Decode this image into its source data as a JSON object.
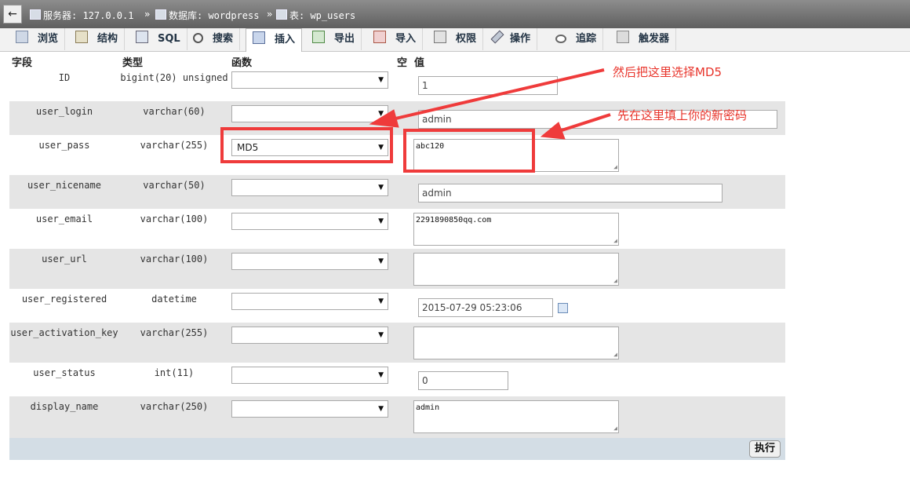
{
  "breadcrumb": {
    "back": "←",
    "server": "服务器: 127.0.0.1",
    "database": "数据库: wordpress",
    "table": "表: wp_users",
    "sep": "»"
  },
  "tabs": [
    "浏览",
    "结构",
    "SQL",
    "搜索",
    "插入",
    "导出",
    "导入",
    "权限",
    "操作",
    "追踪",
    "触发器"
  ],
  "active_tab": "插入",
  "columns": {
    "field": "字段",
    "type": "类型",
    "function": "函数",
    "null": "空",
    "value": "值"
  },
  "rows": [
    {
      "field": "ID",
      "type": "bigint(20) unsigned",
      "function": "",
      "value": "1"
    },
    {
      "field": "user_login",
      "type": "varchar(60)",
      "function": "",
      "value": "admin"
    },
    {
      "field": "user_pass",
      "type": "varchar(255)",
      "function": "MD5",
      "value": "abc120"
    },
    {
      "field": "user_nicename",
      "type": "varchar(50)",
      "function": "",
      "value": "admin"
    },
    {
      "field": "user_email",
      "type": "varchar(100)",
      "function": "",
      "value": "2291890850qq.com"
    },
    {
      "field": "user_url",
      "type": "varchar(100)",
      "function": "",
      "value": ""
    },
    {
      "field": "user_registered",
      "type": "datetime",
      "function": "",
      "value": "2015-07-29 05:23:06"
    },
    {
      "field": "user_activation_key",
      "type": "varchar(255)",
      "function": "",
      "value": ""
    },
    {
      "field": "user_status",
      "type": "int(11)",
      "function": "",
      "value": "0"
    },
    {
      "field": "display_name",
      "type": "varchar(250)",
      "function": "",
      "value": "admin"
    }
  ],
  "execute_label": "执行",
  "annotations": {
    "md5_note": "然后把这里选择MD5",
    "password_note": "先在这里填上你的新密码"
  },
  "colors": {
    "annotation": "#e8342b",
    "row_alt": "#e5e5e5",
    "footer": "#d3dde5"
  }
}
